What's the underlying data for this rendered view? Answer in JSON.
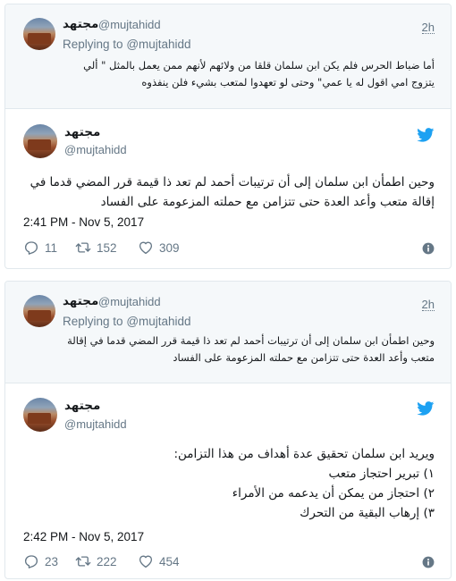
{
  "tweets": [
    {
      "quoted": {
        "name": "مجتهد",
        "handle": "@mujtahidd",
        "time": "2h",
        "replying_label": "Replying to",
        "replying_handle": "@mujtahidd",
        "text": "أما ضباط الحرس فلم يكن ابن سلمان قلقا من ولائهم لأنهم ممن يعمل بالمثل \" ألي يتزوج امي اقول له يا عمي\" وحتى لو تعهدوا لمتعب بشيء فلن ينفذوه"
      },
      "main": {
        "name": "مجتهد",
        "handle": "@mujtahidd",
        "text": "وحين اطمأن ابن سلمان إلى أن ترتيبات أحمد لم تعد ذا قيمة قرر المضي قدما في إقالة متعب وأعد العدة حتى تتزامن مع حملته المزعومة على الفساد",
        "timestamp": "2:41 PM - Nov 5, 2017",
        "replies": "11",
        "retweets": "152",
        "likes": "309"
      }
    },
    {
      "quoted": {
        "name": "مجتهد",
        "handle": "@mujtahidd",
        "time": "2h",
        "replying_label": "Replying to",
        "replying_handle": "@mujtahidd",
        "text": "وحين اطمأن ابن سلمان إلى أن ترتيبات أحمد لم تعد ذا قيمة قرر المضي قدما في إقالة متعب وأعد العدة حتى تتزامن مع حملته المزعومة على الفساد"
      },
      "main": {
        "name": "مجتهد",
        "handle": "@mujtahidd",
        "text_lines": [
          "ويريد ابن سلمان تحقيق عدة أهداف من هذا التزامن:",
          "١) تبرير احتجاز متعب",
          "٢) احتجاز من يمكن أن يدعمه من الأمراء",
          "٣) إرهاب البقية من التحرك"
        ],
        "timestamp": "2:42 PM - Nov 5, 2017",
        "replies": "23",
        "retweets": "222",
        "likes": "454"
      }
    }
  ],
  "icons": {
    "brand": "twitter-bird-icon",
    "reply": "reply-icon",
    "retweet": "retweet-icon",
    "like": "heart-icon",
    "info": "info-icon"
  },
  "colors": {
    "twitter_blue": "#1da1f2",
    "text": "#14171a",
    "muted": "#657786",
    "border": "#e1e8ed",
    "quote_bg": "#f5f8fa"
  }
}
